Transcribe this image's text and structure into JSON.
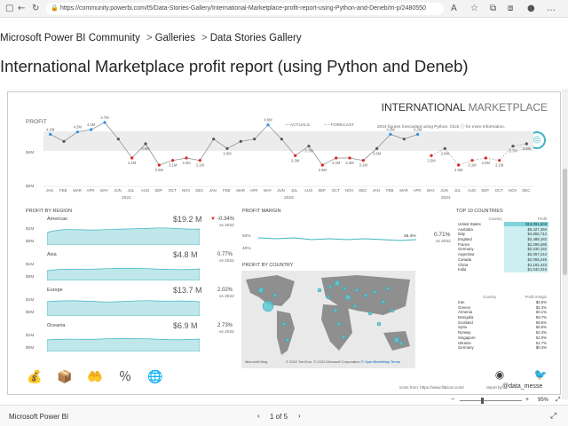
{
  "browser": {
    "url": "https://community.powerbi.com/t5/Data-Stories-Gallery/International-Marketplace-profit-report-using-Python-and-Deneb/m-p/2480550"
  },
  "breadcrumb": {
    "items": [
      "Microsoft Power BI Community",
      "Galleries",
      "Data Stories Gallery"
    ],
    "separator": ">"
  },
  "page": {
    "title": "International Marketplace profit report (using Python and Deneb)"
  },
  "report": {
    "brand_bold": "INTERNATIONAL",
    "brand_light": " MARKETPLACE",
    "profit_label": "PROFIT",
    "legend_actuals": "ACTUALS",
    "legend_forecast": "FORECAST",
    "forecast_note": "2024 figures forecasted using Python. Click",
    "forecast_note2": "for more information.",
    "y_ticks": [
      "$4M",
      "$2M"
    ],
    "months": [
      "JAN",
      "FEB",
      "MAR",
      "APR",
      "MAY",
      "JUN",
      "JUL",
      "AUG",
      "SEP",
      "OCT",
      "NOV",
      "DEC",
      "JAN",
      "FEB",
      "MAR",
      "APR",
      "MAY",
      "JUN",
      "JUL",
      "AUG",
      "SEP",
      "OCT",
      "NOV",
      "DEC",
      "JAN",
      "FEB",
      "MAR",
      "APR",
      "MAY",
      "JUN",
      "JUL",
      "AUG",
      "SEP",
      "OCT",
      "NOV",
      "DEC"
    ],
    "years": [
      "2022",
      "2023",
      "2024"
    ],
    "region_title": "PROFIT BY REGION",
    "regions": [
      {
        "name": "Americas",
        "value": "$19.2 M",
        "change": "-0.34%",
        "vs": "vs 2022",
        "down": true,
        "ticks": [
          "$1M",
          "$0M"
        ]
      },
      {
        "name": "Asia",
        "value": "$4.8 M",
        "change": "0.77%",
        "vs": "vs 2022",
        "down": false,
        "ticks": [
          "$1M",
          "$0M"
        ]
      },
      {
        "name": "Europe",
        "value": "$13.7 M",
        "change": "2.02%",
        "vs": "vs 2022",
        "down": false,
        "ticks": [
          "$1M",
          "$0M"
        ]
      },
      {
        "name": "Oceania",
        "value": "$6.9 M",
        "change": "2.73%",
        "vs": "vs 2022",
        "down": false,
        "ticks": [
          "$1M",
          "$0M"
        ]
      }
    ],
    "margin_title": "PROFIT MARGIN",
    "margin_ticks": [
      "50%",
      "40%"
    ],
    "margin_value": "46.4%",
    "margin_change": "0.71%",
    "margin_vs": "vs 2022",
    "country_title": "PROFIT BY COUNTRY",
    "map_credit": "© 2022 TomTom, © 2022 Microsoft Corporation",
    "map_link": "© OpenStreetMap",
    "map_terms": "Terms",
    "map_logo": "Microsoft Bing",
    "top10_title": "TOP 10 COUNTRIES",
    "top_profit_headers": [
      "Country",
      "Profit"
    ],
    "top_profit": [
      [
        "United States",
        "$13,091,503"
      ],
      [
        "Australia",
        "$6,427,394"
      ],
      [
        "Italy",
        "$4,855,712"
      ],
      [
        "England",
        "$2,488,182"
      ],
      [
        "France",
        "$2,299,285"
      ],
      [
        "Germany",
        "$2,230,182"
      ],
      [
        "Argentina",
        "$2,067,244"
      ],
      [
        "Canada",
        "$2,055,245"
      ],
      [
        "China",
        "$1,182,423"
      ],
      [
        "India",
        "$1,040,316"
      ]
    ],
    "top_margin_headers": [
      "Country",
      "Profit margin"
    ],
    "top_margin": [
      [
        "Iran",
        "$2.6%"
      ],
      [
        "Greece",
        "$2.4%"
      ],
      [
        "Armenia",
        "60.1%"
      ],
      [
        "Mongolia",
        "59.7%"
      ],
      [
        "Scotland",
        "58.6%"
      ],
      [
        "Syria",
        "55.6%"
      ],
      [
        "Norway",
        "52.4%"
      ],
      [
        "Singapore",
        "52.0%"
      ],
      [
        "Ukraine",
        "51.7%"
      ],
      [
        "Germany",
        "$0.4%"
      ]
    ],
    "icons_credit": "icons from: https://www.flaticon.com/",
    "report_by": "report by",
    "author": "@data_messe"
  },
  "footer": {
    "app_name": "Microsoft Power BI",
    "page_indicator": "1 of 5",
    "zoom": "95%"
  },
  "chart_data": {
    "type": "line",
    "title": "PROFIT",
    "ylabel": "",
    "ylim": [
      2,
      5
    ],
    "x": [
      "JAN 2022",
      "FEB 2022",
      "MAR 2022",
      "APR 2022",
      "MAY 2022",
      "JUN 2022",
      "JUL 2022",
      "AUG 2022",
      "SEP 2022",
      "OCT 2022",
      "NOV 2022",
      "DEC 2022",
      "JAN 2023",
      "FEB 2023",
      "MAR 2023",
      "APR 2023",
      "MAY 2023",
      "JUN 2023",
      "JUL 2023",
      "AUG 2023",
      "SEP 2023",
      "OCT 2023",
      "NOV 2023",
      "DEC 2023",
      "JAN 2024",
      "FEB 2024",
      "MAR 2024",
      "APR 2024",
      "MAY 2024",
      "JUN 2024",
      "JUL 2024",
      "AUG 2024",
      "SEP 2024",
      "OCT 2024",
      "NOV 2024",
      "DEC 2024"
    ],
    "series": [
      {
        "name": "ACTUALS",
        "values": [
          4.2,
          3.9,
          4.3,
          4.4,
          4.7,
          4.0,
          3.2,
          3.8,
          2.9,
          3.1,
          3.2,
          3.1,
          4.0,
          3.6,
          3.9,
          4.0,
          4.6,
          4.0,
          3.3,
          3.7,
          2.9,
          3.2,
          3.2,
          3.1,
          3.6,
          4.2,
          4.0,
          4.2
        ]
      },
      {
        "name": "FORECAST",
        "values": [
          null,
          null,
          null,
          null,
          null,
          null,
          null,
          null,
          null,
          null,
          null,
          null,
          null,
          null,
          null,
          null,
          null,
          null,
          null,
          null,
          null,
          null,
          null,
          null,
          null,
          null,
          null,
          null,
          3.3,
          3.6,
          2.9,
          3.1,
          3.2,
          3.1,
          3.7,
          3.8
        ]
      }
    ],
    "labels": [
      "4.2M",
      "",
      "4.3M",
      "4.4M",
      "4.7M",
      "",
      "3.2M",
      "3.8M",
      "2.9M",
      "3.1M",
      "3.2M",
      "3.1M",
      "",
      "3.6M",
      "",
      "",
      "4.6M",
      "",
      "3.3M",
      "3.7M",
      "2.9M",
      "3.2M",
      "3.2M",
      "3.1M",
      "3.6M",
      "4.2M",
      "",
      "4.2M",
      "3.3M",
      "3.6M",
      "2.9M",
      "3.1M",
      "3.2M",
      "3.1M",
      "3.7M",
      "3.8M"
    ]
  }
}
